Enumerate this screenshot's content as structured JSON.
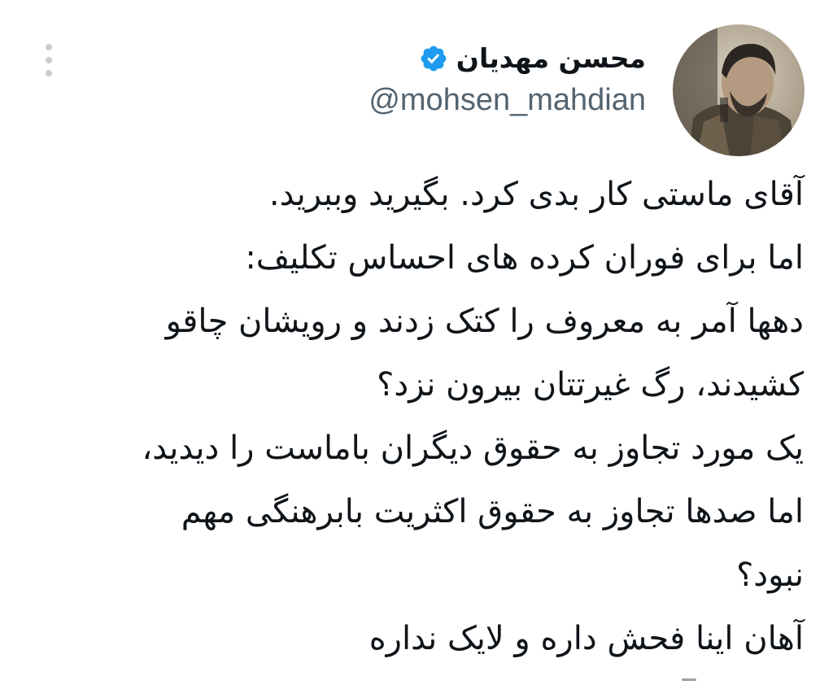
{
  "author": {
    "display_name": "محسن مهدیان",
    "handle": "@mohsen_mahdian",
    "verified": true
  },
  "tweet": {
    "lines": [
      "آقای ماستی کار بدی کرد. بگیرید وببرید.",
      "اما برای فوران کرده های احساس تکلیف:",
      "دهها آمر به معروف را کتک زدند و رویشان چاقو",
      "کشیدند، رگ غیرتتان بیرون نزد؟",
      "یک مورد تجاوز به حقوق دیگران باماست را دیدید،",
      "اما صدها تجاوز به حقوق اکثریت بابرهنگی مهم",
      "نبود؟",
      "آهان اینا فحش داره و لایک نداره"
    ]
  },
  "icons": {
    "more": "more-vertical-icon",
    "verified": "verified-badge-icon"
  },
  "colors": {
    "text": "#0f1419",
    "secondary_text": "#536471",
    "verified_blue": "#1d9bf0",
    "menu_dots": "#c8ccd0"
  }
}
